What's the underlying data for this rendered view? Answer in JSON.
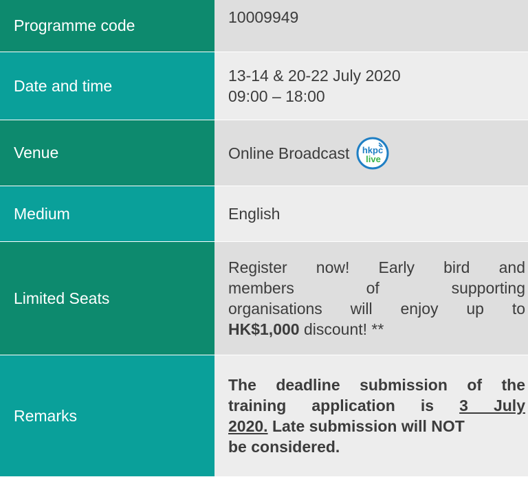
{
  "rows": [
    {
      "label": "Programme code",
      "value": "10009949"
    },
    {
      "label": "Date and time",
      "value_lines": [
        "13-14 & 20-22 July 2020",
        "09:00 – 18:00"
      ]
    },
    {
      "label": "Venue",
      "value": "Online Broadcast",
      "logo": {
        "top": "hkpc",
        "bottom": "live"
      }
    },
    {
      "label": "Medium",
      "value": "English"
    },
    {
      "label": "Limited Seats",
      "value_parts": {
        "line1": "Register now! Early bird and",
        "line2": "members of supporting",
        "line3": "organisations will enjoy up to",
        "amount": "HK$1,000",
        "tail": " discount! **"
      }
    },
    {
      "label": "Remarks",
      "value_parts": {
        "line1": "The deadline submission of the",
        "line2a": "training application is ",
        "date": "3 July",
        "date2": "2020.",
        "line3b": " Late submission will NOT",
        "line4": "be considered."
      }
    }
  ],
  "colors": {
    "label_dark": "#0d8a6e",
    "label_light": "#0aa09a",
    "value_dark": "#dedede",
    "value_light": "#ededed",
    "logo_blue": "#1f7fc4",
    "logo_green": "#3bb54a"
  }
}
